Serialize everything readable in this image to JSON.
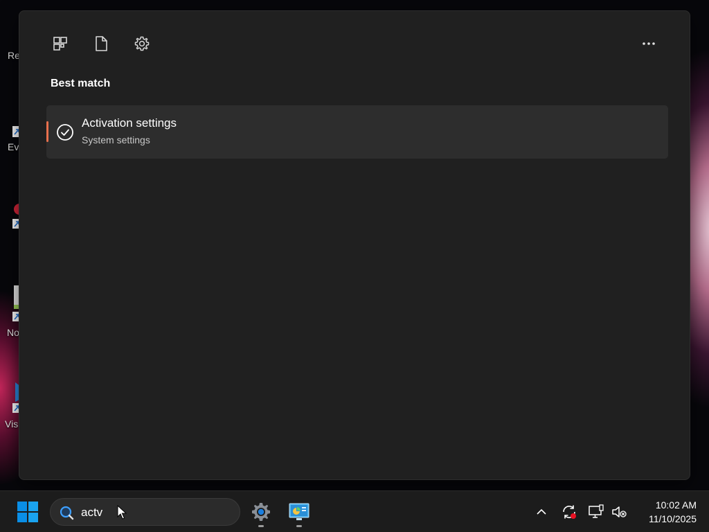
{
  "desktop": {
    "icons": [
      {
        "label": "Re"
      },
      {
        "label": "Ev"
      },
      {
        "label": ""
      },
      {
        "label": "No"
      },
      {
        "label": "Vis"
      }
    ]
  },
  "panel": {
    "toolbar": {
      "apps_icon": "apps-grid-icon",
      "documents_icon": "document-icon",
      "settings_icon": "gear-icon",
      "more_icon": "more-dots-icon"
    },
    "section_title": "Best match",
    "best_match": {
      "title": "Activation settings",
      "subtitle": "System settings",
      "icon": "check-circle-icon",
      "accent_color": "#e8704d"
    }
  },
  "taskbar": {
    "search": {
      "value": "actv",
      "icon": "search-icon"
    },
    "apps": [
      {
        "name": "Settings",
        "icon": "settings-gear-icon"
      },
      {
        "name": "Control Panel",
        "icon": "control-panel-icon"
      }
    ],
    "tray": {
      "chevron_icon": "chevron-up-icon",
      "sync_icon": "sync-icon",
      "network_icon": "network-icon",
      "volume_icon": "volume-muted-icon"
    },
    "clock": {
      "time": "10:02 AM",
      "date": "11/10/2025"
    }
  },
  "colors": {
    "panel_bg": "#202020",
    "result_bg": "#2d2d2d",
    "taskbar_bg": "#1c1c1c",
    "accent": "#e8704d",
    "windows_blue": "#0a8ee6"
  }
}
